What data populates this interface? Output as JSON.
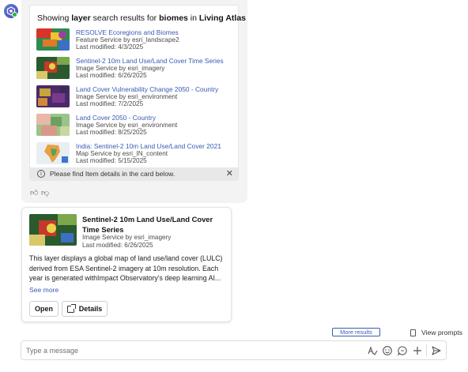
{
  "results": {
    "title_prefix": "Showing ",
    "title_kw1": "layer",
    "title_mid": " search results for ",
    "title_kw2": "biomes",
    "title_mid2": " in ",
    "title_kw3": "Living Atlas",
    "items": [
      {
        "title": "RESOLVE Ecoregions and Biomes",
        "type": "Feature Service by esri_landscape2",
        "modified": "Last modified: 4/3/2025"
      },
      {
        "title": "Sentinel-2 10m Land Use/Land Cover Time Series",
        "type": "Image Service by esri_imagery",
        "modified": "Last modified: 6/26/2025"
      },
      {
        "title": "Land Cover Vulnerability Change 2050 - Country",
        "type": "Image Service by esri_environment",
        "modified": "Last modified: 7/2/2025"
      },
      {
        "title": "Land Cover 2050 - Country",
        "type": "Image Service by esri_environment",
        "modified": "Last modified: 8/25/2025"
      },
      {
        "title": "India: Sentinel-2 10m Land Use/Land Cover 2021",
        "type": "Map Service by esri_IN_content",
        "modified": "Last modified: 5/15/2025"
      }
    ],
    "notice": "Please find Item details in the card below.",
    "notice_icon": "info-icon",
    "close_icon": "close-icon"
  },
  "feedback": {
    "like_icon": "thumbs-up-icon",
    "dislike_icon": "thumbs-down-icon"
  },
  "item_card": {
    "title": "Sentinel-2 10m Land Use/Land Cover Time Series",
    "type": "Image Service by esri_imagery",
    "modified": "Last modified: 6/26/2025",
    "description": "This layer displays a global map of land use/land cover (LULC) derived from ESA Sentinel-2 imagery at 10m resolution. Each year is generated withImpact Observatory's deep learning AI...",
    "see_more": "See more",
    "open_label": "Open",
    "details_label": "Details"
  },
  "footer": {
    "more_results": "More results",
    "view_prompts": "View prompts"
  },
  "composer": {
    "placeholder": "Type a message",
    "icons": [
      "spellcheck-icon",
      "emoji-icon",
      "chat-icon",
      "add-icon",
      "send-icon"
    ]
  },
  "colors": {
    "link": "#3a5bb5",
    "bubble": "#f3f3f3",
    "status_online": "#35ac46"
  }
}
